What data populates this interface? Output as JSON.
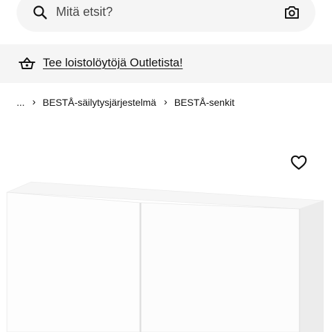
{
  "search": {
    "placeholder": "Mitä etsit?",
    "search_icon": "search-icon",
    "camera_icon": "camera-icon"
  },
  "promo": {
    "icon": "basket-icon",
    "link_text": "Tee loistolöytöjä Outletista!"
  },
  "breadcrumb": {
    "ellipsis": "...",
    "separator": "›",
    "items": [
      "BESTÅ-säilytysjärjestelmä",
      "BESTÅ-senkit"
    ]
  },
  "product": {
    "favourite_icon": "heart-icon",
    "image": "white-sideboard-two-doors"
  },
  "colors": {
    "search_bg": "#f5f5f5",
    "banner_bg": "#f5f5f5",
    "text": "#111111",
    "placeholder": "#484848"
  }
}
